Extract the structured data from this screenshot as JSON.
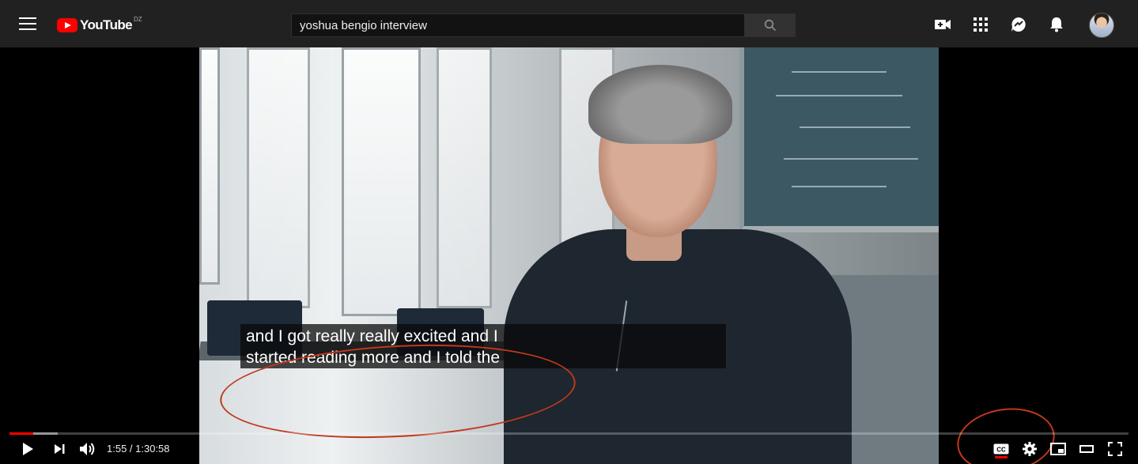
{
  "header": {
    "logo_text": "YouTube",
    "region": "DZ",
    "search_value": "yoshua bengio interview",
    "search_placeholder": "Search"
  },
  "player": {
    "captions": [
      "and I got really really excited and I",
      "started reading more and I told the"
    ],
    "time_current": "1:55",
    "time_total": "1:30:58",
    "time_display": "1:55 / 1:30:58",
    "progress_played": 0.021,
    "progress_loaded": 0.043
  },
  "colors": {
    "brand": "#ff0000",
    "masthead_bg": "#212121",
    "annotation": "#c0391b"
  },
  "icons": {
    "menu": "hamburger-menu-icon",
    "search": "search-icon",
    "create": "video-camera-add-icon",
    "apps": "apps-grid-icon",
    "messages": "messages-icon",
    "notifications": "bell-icon",
    "play": "play-icon",
    "next": "next-icon",
    "volume": "volume-icon",
    "captions": "closed-captions-icon",
    "settings": "gear-icon",
    "miniplayer": "miniplayer-icon",
    "theater": "theater-mode-icon",
    "fullscreen": "fullscreen-icon"
  }
}
